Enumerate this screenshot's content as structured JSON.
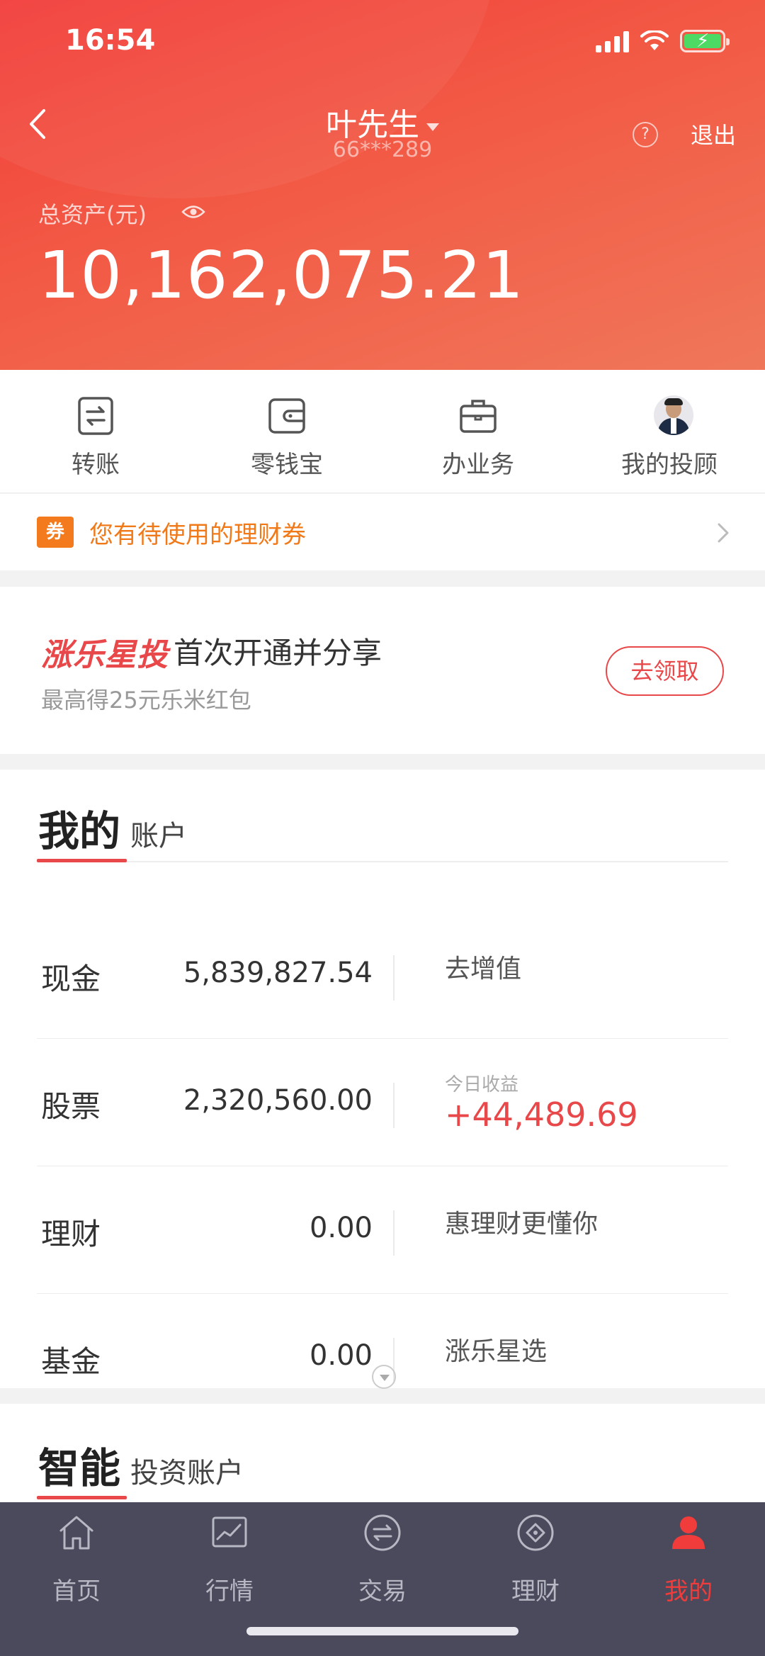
{
  "status_bar": {
    "time": "16:54"
  },
  "header": {
    "user_name": "叶先生",
    "account_masked": "66***289",
    "help_icon": "?",
    "logout_label": "退出",
    "asset_label": "总资产(元)",
    "asset_value": "10,162,075.21"
  },
  "quick_actions": [
    {
      "label": "转账",
      "icon": "transfer-icon"
    },
    {
      "label": "零钱宝",
      "icon": "wallet-icon"
    },
    {
      "label": "办业务",
      "icon": "briefcase-icon"
    },
    {
      "label": "我的投顾",
      "icon": "advisor-avatar"
    }
  ],
  "coupon": {
    "badge": "券",
    "text": "您有待使用的理财券"
  },
  "promo": {
    "brand": "涨乐星投",
    "title": "首次开通并分享",
    "subtitle": "最高得25元乐米红包",
    "button": "去领取"
  },
  "account": {
    "title_big": "我的",
    "title_small": "账户",
    "rows": [
      {
        "name": "现金",
        "amount": "5,839,827.54",
        "action": "去增值"
      },
      {
        "name": "股票",
        "amount": "2,320,560.00",
        "today_label": "今日收益",
        "today_value": "+44,489.69"
      },
      {
        "name": "理财",
        "amount": "0.00",
        "action": "惠理财更懂你"
      },
      {
        "name": "基金",
        "amount": "0.00",
        "action": "涨乐星选"
      }
    ]
  },
  "smart": {
    "title_big": "智能",
    "title_small": "投资账户"
  },
  "tabbar": [
    {
      "label": "首页",
      "icon": "home-icon",
      "active": false
    },
    {
      "label": "行情",
      "icon": "chart-icon",
      "active": false
    },
    {
      "label": "交易",
      "icon": "trade-icon",
      "active": false
    },
    {
      "label": "理财",
      "icon": "finance-icon",
      "active": false
    },
    {
      "label": "我的",
      "icon": "profile-icon",
      "active": true
    }
  ],
  "colors": {
    "brand_red": "#e8484a",
    "coupon_orange": "#f07a1a",
    "tabbar_bg": "#4a4a5c",
    "tab_active": "#f03c3a"
  }
}
